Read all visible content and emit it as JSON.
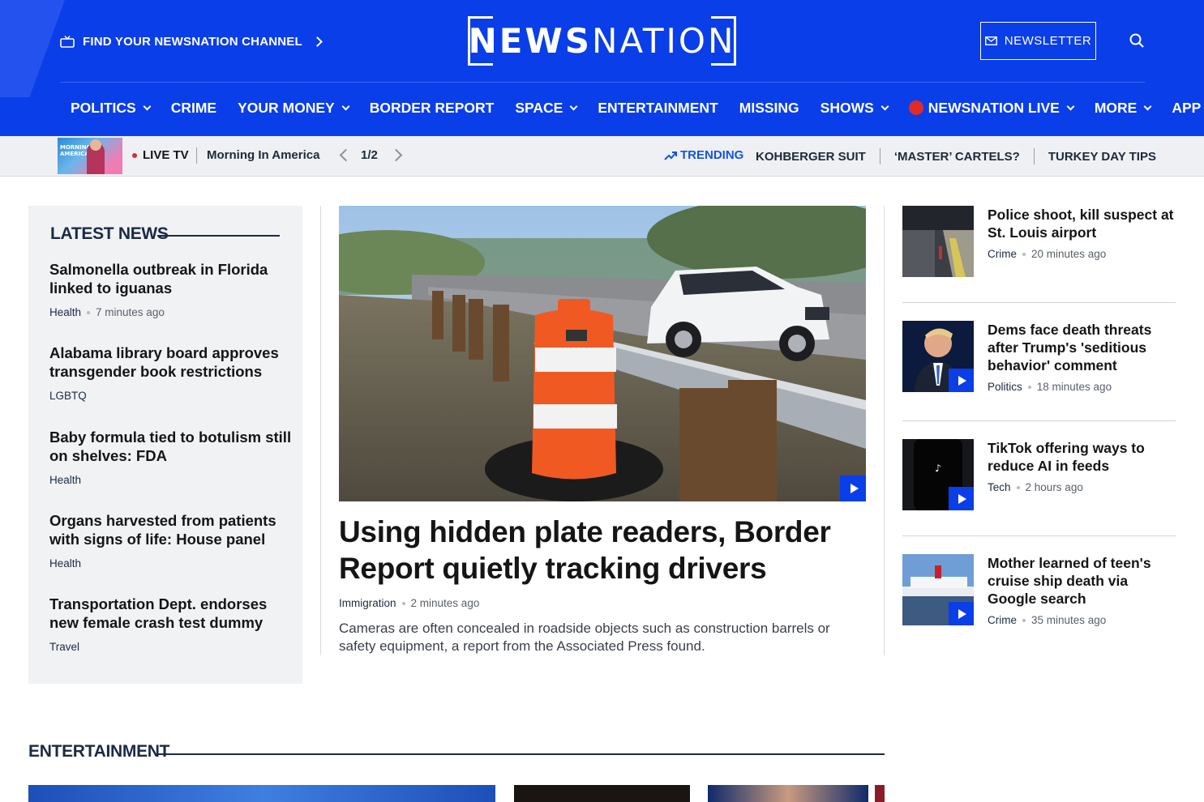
{
  "header": {
    "find_channel_label": "FIND YOUR NEWSNATION CHANNEL",
    "logo_bold": "NEWS",
    "logo_light": "NATION",
    "newsletter_label": "NEWSLETTER",
    "brand_color": "#0a3ee8"
  },
  "nav": {
    "items": [
      {
        "label": "POLITICS",
        "dropdown": true
      },
      {
        "label": "CRIME",
        "dropdown": false
      },
      {
        "label": "YOUR MONEY",
        "dropdown": true
      },
      {
        "label": "BORDER REPORT",
        "dropdown": false
      },
      {
        "label": "SPACE",
        "dropdown": true
      },
      {
        "label": "ENTERTAINMENT",
        "dropdown": false
      },
      {
        "label": "MISSING",
        "dropdown": false
      },
      {
        "label": "SHOWS",
        "dropdown": true
      },
      {
        "label": "NEWSNATION LIVE",
        "dropdown": true,
        "live": true
      },
      {
        "label": "MORE",
        "dropdown": true
      },
      {
        "label": "APP",
        "dropdown": false
      }
    ]
  },
  "subbar": {
    "live_label": "LIVE TV",
    "show_name": "Morning In America",
    "pagination": "1/2",
    "thumb_text": "MORNING AMERICA",
    "trending_label": "TRENDING",
    "trending_links": [
      "KOHBERGER SUIT",
      "‘MASTER’ CARTELS?",
      "TURKEY DAY TIPS"
    ]
  },
  "latest_news": {
    "title": "LATEST NEWS",
    "items": [
      {
        "headline": "Salmonella outbreak in Florida linked to iguanas",
        "category": "Health",
        "time": "7 minutes ago"
      },
      {
        "headline": "Alabama library board approves transgender book restrictions",
        "category": "LGBTQ",
        "time": ""
      },
      {
        "headline": "Baby formula tied to botulism still on shelves: FDA",
        "category": "Health",
        "time": ""
      },
      {
        "headline": "Organs harvested from patients with signs of life: House panel",
        "category": "Health",
        "time": ""
      },
      {
        "headline": "Transportation Dept. endorses new female crash test dummy",
        "category": "Travel",
        "time": ""
      }
    ]
  },
  "main_story": {
    "headline": "Using hidden plate readers, Border Report quietly tracking drivers",
    "category": "Immigration",
    "time": "2 minutes ago",
    "description": "Cameras are often concealed in roadside objects such as construction barrels or safety equipment, a report from the Associated Press found."
  },
  "side_stories": [
    {
      "headline": "Police shoot, kill suspect at St. Louis airport",
      "category": "Crime",
      "time": "20 minutes ago",
      "video": false
    },
    {
      "headline": "Dems face death threats after Trump's 'seditious behavior' comment",
      "category": "Politics",
      "time": "18 minutes ago",
      "video": true
    },
    {
      "headline": "TikTok offering ways to reduce AI in feeds",
      "category": "Tech",
      "time": "2 hours ago",
      "video": true
    },
    {
      "headline": "Mother learned of teen's cruise ship death via Google search",
      "category": "Crime",
      "time": "35 minutes ago",
      "video": true
    }
  ],
  "entertainment": {
    "title": "ENTERTAINMENT"
  }
}
